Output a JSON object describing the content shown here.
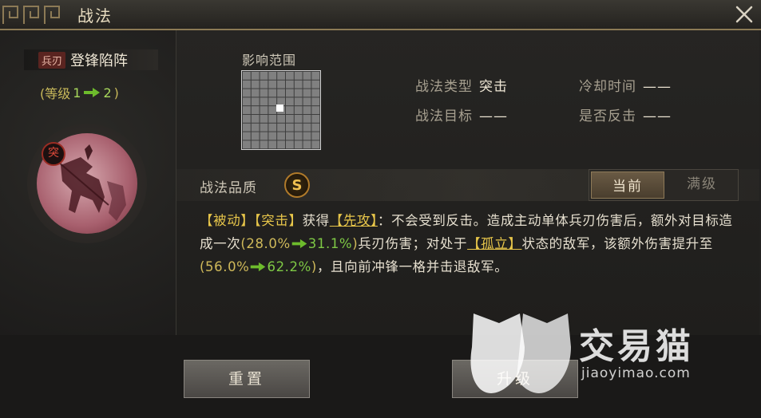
{
  "window": {
    "title": "战法"
  },
  "skill": {
    "type_tag": "兵刃",
    "name": "登锋陷阵",
    "level_prefix": "(等级",
    "level_from": "1",
    "level_to": "2",
    "level_suffix": ")",
    "portrait_badge": "突"
  },
  "range": {
    "label": "影响范围",
    "grid_size": 9,
    "center_cell": [
      4,
      4
    ]
  },
  "info": {
    "type_label": "战法类型",
    "type_value": "突击",
    "cooldown_label": "冷却时间",
    "cooldown_value": "——",
    "target_label": "战法目标",
    "target_value": "——",
    "counter_label": "是否反击",
    "counter_value": "——"
  },
  "quality": {
    "label": "战法品质",
    "grade": "S"
  },
  "tabs": [
    {
      "label": "当前",
      "active": true
    },
    {
      "label": "满级",
      "active": false
    }
  ],
  "description": {
    "kw1": "【被动】",
    "kw2": "【突击】",
    "t1": "获得",
    "kw3": "【先攻】",
    "t2": "：不会受到反击。造成主动单体兵刃伤害后，额外对目标造成一次",
    "p1_open": "(",
    "p1_old": "28.0%",
    "p1_new": "31.1%",
    "p1_close": ")",
    "t3": "兵刃伤害；对处于",
    "kw4": "【孤立】",
    "t4": "状态的敌军，该额外伤害提升至",
    "p2_open": "(",
    "p2_old": "56.0%",
    "p2_new": "62.2%",
    "p2_close": ")",
    "t5": "，且向前冲锋一格并击退敌军。"
  },
  "buttons": {
    "reset": "重置",
    "upgrade": "升级"
  },
  "watermark": {
    "brand": "交易猫",
    "url": "jiaoyimao.com"
  },
  "colors": {
    "accent_gold": "#e8c64a",
    "arrow_green": "#6dbb2c",
    "badge_red": "#9a2c23"
  }
}
